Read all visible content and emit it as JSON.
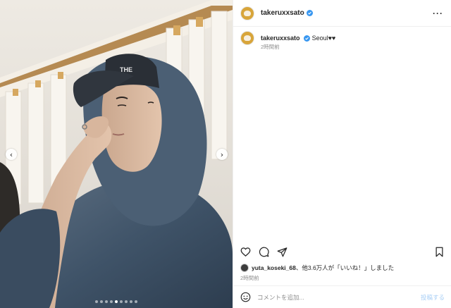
{
  "account": {
    "username": "takeruxxsato",
    "verified": true,
    "avatar_color": "#d8a53a"
  },
  "header": {
    "more_icon": "more-horizontal-icon"
  },
  "caption": {
    "username": "takeruxxsato",
    "text": "Seoul♥︎♥︎",
    "time": "2時間前"
  },
  "media": {
    "carousel_dots": 9,
    "active_dot": 4,
    "prev_icon": "chevron-left-icon",
    "next_icon": "chevron-right-icon",
    "cap_text": "THE"
  },
  "actions": {
    "icons": [
      "heart-icon",
      "comment-icon",
      "share-icon",
      "bookmark-icon"
    ]
  },
  "likes": {
    "user": "yuta_koseki_68",
    "text": "、他3.6万人が「いいね！」しました"
  },
  "post_time": "2時間前",
  "comment": {
    "placeholder": "コメントを追加...",
    "post_label": "投稿する"
  },
  "colors": {
    "verified": "#3897f0",
    "post_button": "#a8cff6",
    "secondary_text": "#8e8e8e"
  }
}
